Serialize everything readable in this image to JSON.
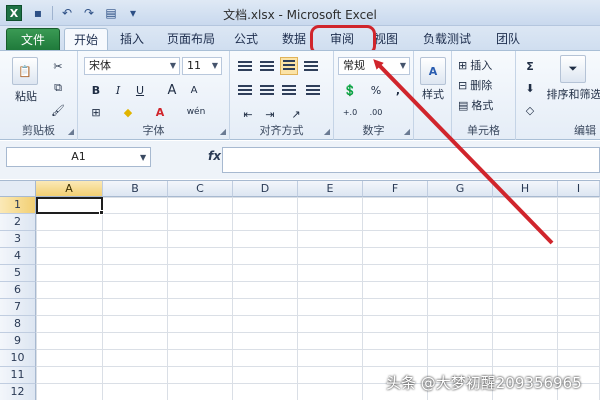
{
  "window": {
    "title": "文档.xlsx - Microsoft Excel",
    "app_icon": "X"
  },
  "tabs": {
    "file": "文件",
    "home": "开始",
    "insert": "插入",
    "layout": "页面布局",
    "formulas": "公式",
    "data": "数据",
    "review": "审阅",
    "view": "视图",
    "load_test": "负载测试",
    "team": "团队"
  },
  "ribbon": {
    "clipboard": {
      "label": "剪贴板",
      "paste": "粘贴"
    },
    "font": {
      "label": "字体",
      "name": "宋体",
      "size": "11",
      "bold": "B",
      "italic": "I",
      "underline": "U",
      "grow": "A",
      "shrink": "A",
      "wen": "wén"
    },
    "alignment": {
      "label": "对齐方式"
    },
    "number": {
      "label": "数字",
      "format": "常规",
      "percent": "%",
      "comma": ",",
      "inc": "+.0",
      "dec": ".00"
    },
    "styles": {
      "label": "样式"
    },
    "cells": {
      "label": "单元格",
      "insert": "插入",
      "delete": "删除",
      "format": "格式"
    },
    "editing": {
      "label": "编辑",
      "sort_filter": "排序和筛选",
      "sum": "Σ"
    }
  },
  "formula_bar": {
    "name_box": "A1",
    "fx": "fx",
    "value": ""
  },
  "grid": {
    "columns": [
      "A",
      "B",
      "C",
      "D",
      "E",
      "F",
      "G",
      "H",
      "I"
    ],
    "rows": [
      "1",
      "2",
      "3",
      "4",
      "5",
      "6",
      "7",
      "8",
      "9",
      "10",
      "11",
      "12"
    ],
    "selected_cell": "A1"
  },
  "watermark": "头条 @大梦初醒209356965",
  "colors": {
    "file_tab": "#1f7a3b",
    "annotation": "#d0252c",
    "selection": "#f2cf72"
  }
}
